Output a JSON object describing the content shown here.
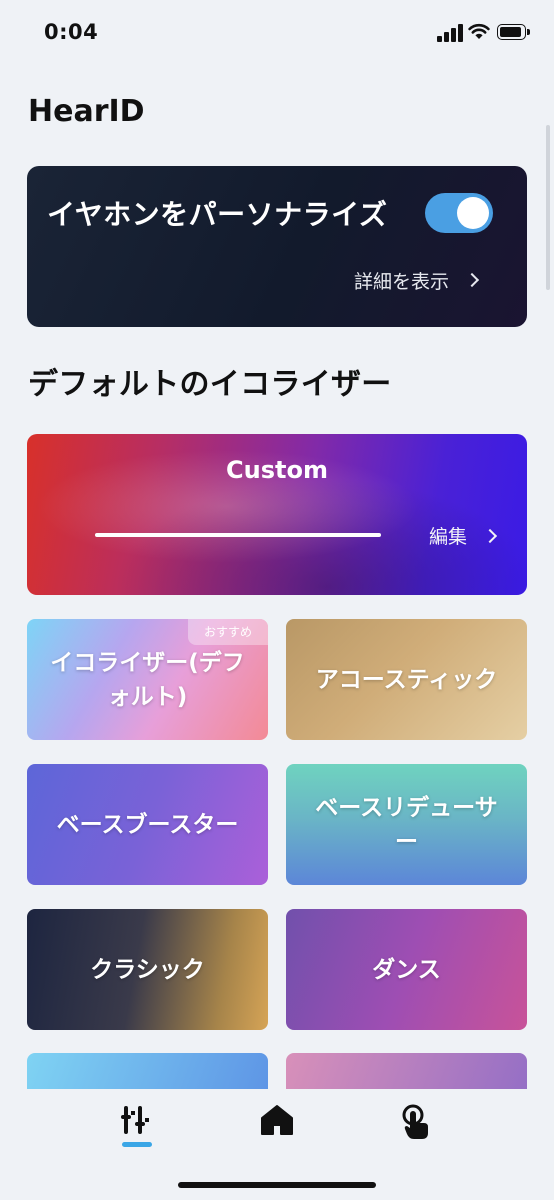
{
  "status_bar": {
    "time": "0:04"
  },
  "header": {
    "title": "HearID"
  },
  "personalize": {
    "title": "イヤホンをパーソナライズ",
    "toggle_on": true,
    "details_label": "詳細を表示"
  },
  "equalizer_section": {
    "heading": "デフォルトのイコライザー",
    "custom": {
      "title": "Custom",
      "edit_label": "編集"
    },
    "presets": [
      {
        "label": "イコライザー(デフォルト)",
        "badge": "おすすめ"
      },
      {
        "label": "アコースティック"
      },
      {
        "label": "ベースブースター"
      },
      {
        "label": "ベースリデューサー"
      },
      {
        "label": "クラシック"
      },
      {
        "label": "ダンス"
      },
      {
        "label": ""
      },
      {
        "label": ""
      }
    ]
  },
  "tab_bar": {
    "tabs": [
      {
        "icon": "equalizer-icon",
        "active": true
      },
      {
        "icon": "home-icon",
        "active": false
      },
      {
        "icon": "touch-icon",
        "active": false
      }
    ],
    "active_color": "#3aa6e6"
  },
  "colors": {
    "background": "#eff2f6",
    "toggle": "#4a9fe3",
    "card_dark": "#141c2e"
  }
}
